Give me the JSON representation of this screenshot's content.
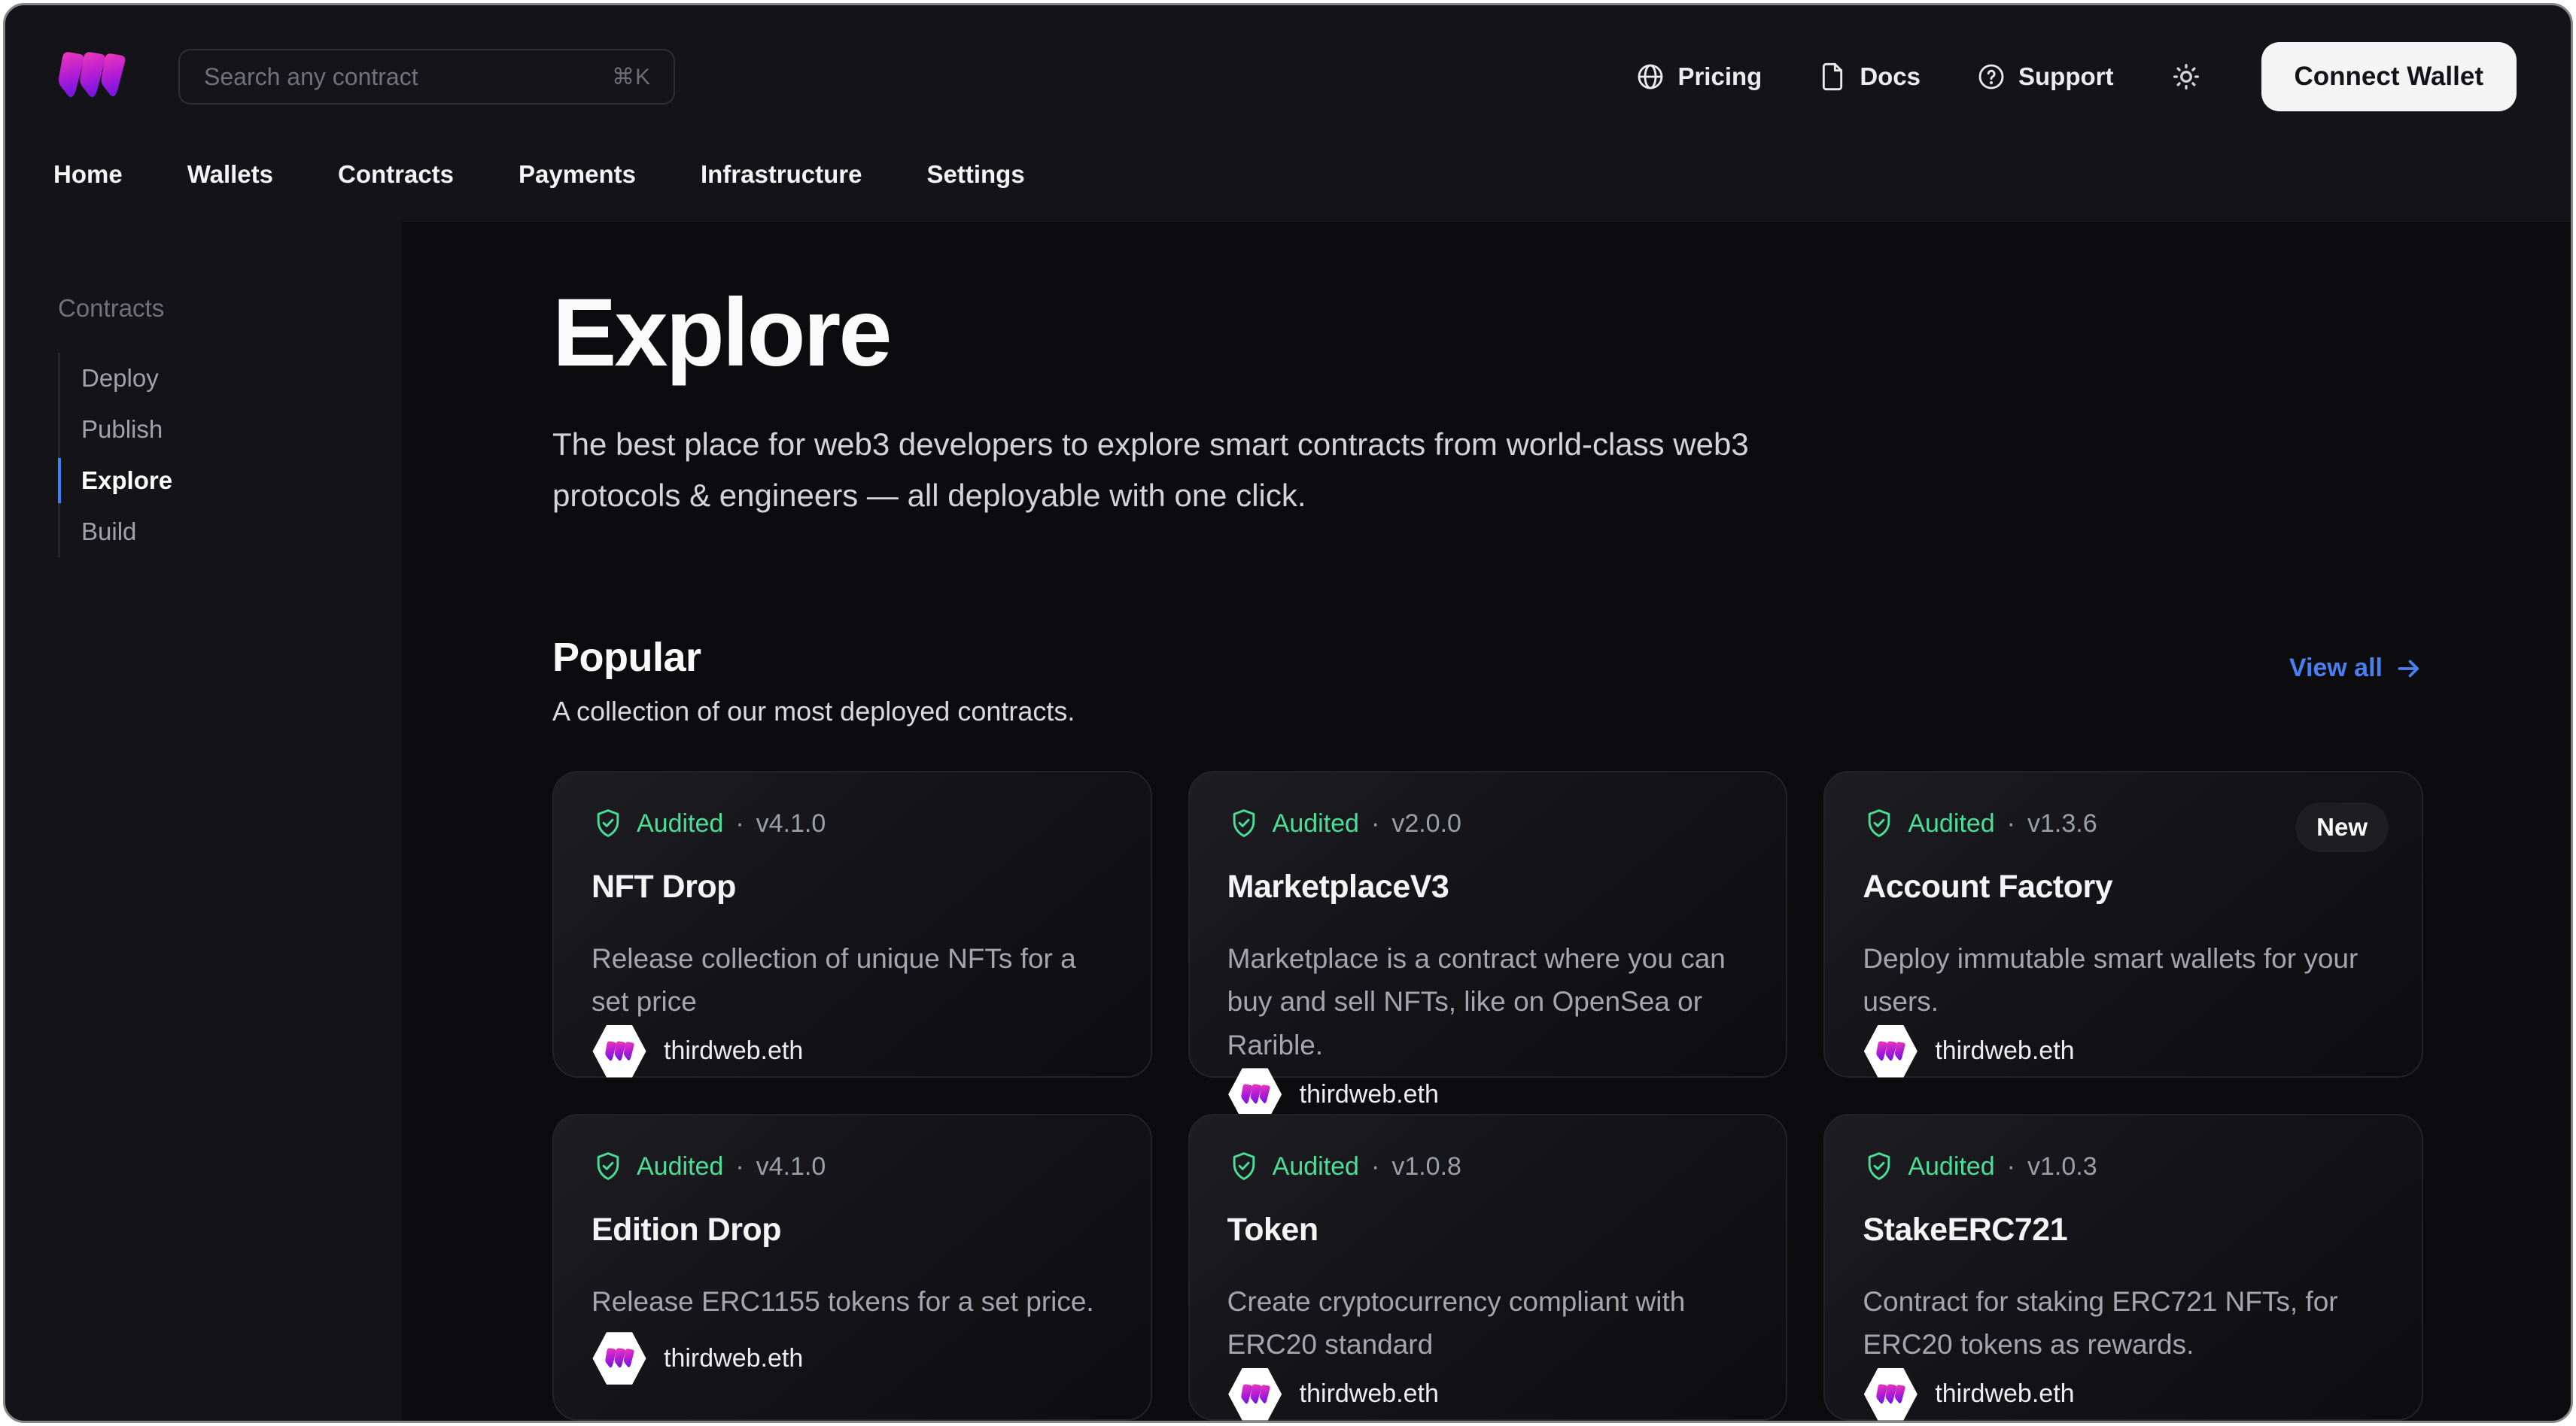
{
  "topbar": {
    "search": {
      "placeholder": "Search any contract",
      "shortcut": "⌘K"
    },
    "links": [
      {
        "icon": "globe-icon",
        "label": "Pricing"
      },
      {
        "icon": "doc-icon",
        "label": "Docs"
      },
      {
        "icon": "help-icon",
        "label": "Support"
      }
    ],
    "connect_wallet_label": "Connect Wallet"
  },
  "nav": {
    "tabs": [
      "Home",
      "Wallets",
      "Contracts",
      "Payments",
      "Infrastructure",
      "Settings"
    ]
  },
  "sidebar": {
    "section_label": "Contracts",
    "items": [
      {
        "label": "Deploy",
        "active": false
      },
      {
        "label": "Publish",
        "active": false
      },
      {
        "label": "Explore",
        "active": true
      },
      {
        "label": "Build",
        "active": false
      }
    ]
  },
  "main": {
    "title": "Explore",
    "subtitle": "The best place for web3 developers to explore smart contracts from world-class web3 protocols & engineers — all deployable with one click.",
    "popular": {
      "title": "Popular",
      "subtitle": "A collection of our most deployed contracts.",
      "view_all_label": "View all"
    },
    "meta_separator": "·",
    "cards": [
      {
        "badge": "Audited",
        "version": "v4.1.0",
        "tag": "",
        "title": "NFT Drop",
        "description": "Release collection of unique NFTs for a set price",
        "publisher": "thirdweb.eth"
      },
      {
        "badge": "Audited",
        "version": "v2.0.0",
        "tag": "",
        "title": "MarketplaceV3",
        "description": "Marketplace is a contract where you can buy and sell NFTs, like on OpenSea or Rarible.",
        "publisher": "thirdweb.eth"
      },
      {
        "badge": "Audited",
        "version": "v1.3.6",
        "tag": "New",
        "title": "Account Factory",
        "description": "Deploy immutable smart wallets for your users.",
        "publisher": "thirdweb.eth"
      },
      {
        "badge": "Audited",
        "version": "v4.1.0",
        "tag": "",
        "title": "Edition Drop",
        "description": "Release ERC1155 tokens for a set price.",
        "publisher": "thirdweb.eth"
      },
      {
        "badge": "Audited",
        "version": "v1.0.8",
        "tag": "",
        "title": "Token",
        "description": "Create cryptocurrency compliant with ERC20 standard",
        "publisher": "thirdweb.eth"
      },
      {
        "badge": "Audited",
        "version": "v1.0.3",
        "tag": "",
        "title": "StakeERC721",
        "description": "Contract for staking ERC721 NFTs, for ERC20 tokens as rewards.",
        "publisher": "thirdweb.eth"
      }
    ]
  },
  "colors": {
    "accent_blue": "#4a7fee",
    "active_indicator_blue": "#3b82f6",
    "audited_green": "#4ade97",
    "brand_pink": "#ec36b4",
    "brand_purple": "#7d15e0",
    "panel_bg": "#0c0c0f",
    "bar_bg": "#141418"
  }
}
